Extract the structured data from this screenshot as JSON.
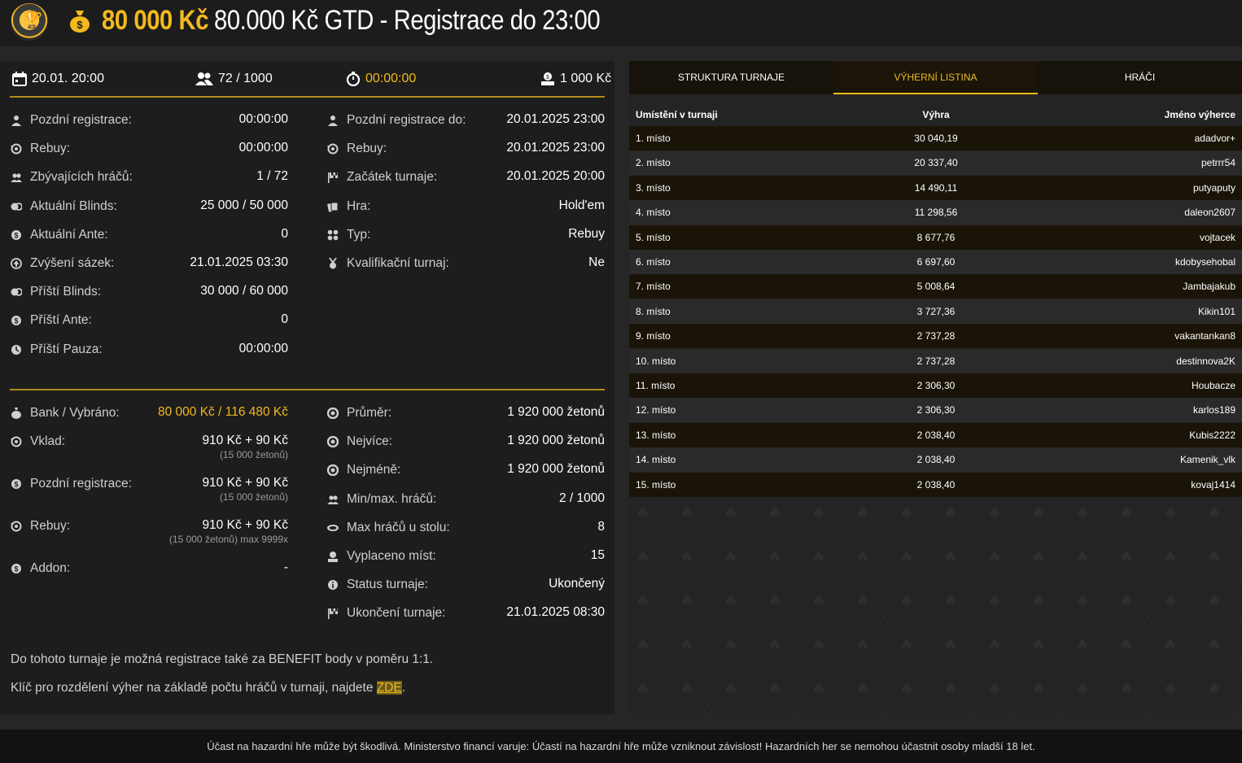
{
  "header": {
    "prize": "80 000 Kč",
    "title": "80.000 Kč GTD - Registrace do 23:00",
    "logo_icon": "trophy-icon",
    "prize_icon": "moneybag-icon"
  },
  "summary": {
    "date": "20.01. 20:00",
    "players": "72 / 1000",
    "timer": "00:00:00",
    "buyin": "1 000 Kč"
  },
  "details_left": [
    {
      "label": "Pozdní registrace:",
      "value": "00:00:00",
      "icon": "user-icon"
    },
    {
      "label": "Rebuy:",
      "value": "00:00:00",
      "icon": "rebuy-icon"
    },
    {
      "label": "Zbývajících hráčů:",
      "value": "1 / 72",
      "icon": "users-icon"
    },
    {
      "label": "Aktuální Blinds:",
      "value": "25 000 / 50 000",
      "icon": "chips-icon"
    },
    {
      "label": "Aktuální Ante:",
      "value": "0",
      "icon": "coin-icon"
    },
    {
      "label": "Zvýšení sázek:",
      "value": "21.01.2025 03:30",
      "icon": "raise-icon"
    },
    {
      "label": "Příští Blinds:",
      "value": "30 000 / 60 000",
      "icon": "chips-icon"
    },
    {
      "label": "Příští Ante:",
      "value": "0",
      "icon": "coin-icon"
    },
    {
      "label": "Příští Pauza:",
      "value": "00:00:00",
      "icon": "clock-icon"
    }
  ],
  "details_right": [
    {
      "label": "Pozdní registrace do:",
      "value": "20.01.2025 23:00",
      "icon": "user-icon"
    },
    {
      "label": "Rebuy:",
      "value": "20.01.2025 23:00",
      "icon": "rebuy-icon"
    },
    {
      "label": "Začátek turnaje:",
      "value": "20.01.2025 20:00",
      "icon": "flag-icon"
    },
    {
      "label": "Hra:",
      "value": "Hold'em",
      "icon": "cards-icon"
    },
    {
      "label": "Typ:",
      "value": "Rebuy",
      "icon": "grid-icon"
    },
    {
      "label": "Kvalifikační turnaj:",
      "value": "Ne",
      "icon": "medal-icon"
    }
  ],
  "money_left": [
    {
      "label": "Bank / Vybráno:",
      "value": "80 000 Kč / 116 480 Kč",
      "sub": "",
      "icon": "moneybag-icon"
    },
    {
      "label": "Vklad:",
      "value": "910 Kč + 90 Kč",
      "sub": "(15 000 žetonů)",
      "icon": "rebuy-icon"
    },
    {
      "label": "Pozdní registrace:",
      "value": "910 Kč + 90 Kč",
      "sub": "(15 000 žetonů)",
      "icon": "coin-icon"
    },
    {
      "label": "Rebuy:",
      "value": "910 Kč + 90 Kč",
      "sub": "(15 000 žetonů) max 9999x",
      "icon": "rebuy-icon"
    },
    {
      "label": "Addon:",
      "value": "-",
      "sub": "",
      "icon": "coin-icon"
    }
  ],
  "money_right": [
    {
      "label": "Průměr:",
      "value": "1 920 000 žetonů",
      "icon": "chip-icon"
    },
    {
      "label": "Nejvíce:",
      "value": "1 920 000 žetonů",
      "icon": "chip-icon"
    },
    {
      "label": "Nejméně:",
      "value": "1 920 000 žetonů",
      "icon": "chip-icon"
    },
    {
      "label": "Min/max. hráčů:",
      "value": "2 / 1000",
      "icon": "users-icon"
    },
    {
      "label": "Max hráčů u stolu:",
      "value": "8",
      "icon": "table-icon"
    },
    {
      "label": "Vyplaceno míst:",
      "value": "15",
      "icon": "payout-icon"
    },
    {
      "label": "Status turnaje:",
      "value": "Ukončený",
      "icon": "info-icon"
    },
    {
      "label": "Ukončení turnaje:",
      "value": "21.01.2025 08:30",
      "icon": "flag-icon"
    }
  ],
  "notes": {
    "benefit": "Do tohoto turnaje je možná registrace také za BENEFIT body v poměru 1:1.",
    "key_text": "Klíč pro rozdělení výher na základě počtu hráčů v turnaji, najdete ",
    "key_link": "ZDE",
    "key_end": "."
  },
  "tabs": [
    "STRUKTURA TURNAJE",
    "VÝHERNÍ LISTINA",
    "HRÁČI"
  ],
  "payout_table": {
    "headers": [
      "Umístění v turnaji",
      "Výhra",
      "Jméno výherce"
    ],
    "rows": [
      [
        "1. místo",
        "30 040,19",
        "adadvor+"
      ],
      [
        "2. místo",
        "20 337,40",
        "petrrr54"
      ],
      [
        "3. místo",
        "14 490,11",
        "putyaputy"
      ],
      [
        "4. místo",
        "11 298,56",
        "daleon2607"
      ],
      [
        "5. místo",
        "8 677,76",
        "vojtacek"
      ],
      [
        "6. místo",
        "6 697,60",
        "kdobysehobal"
      ],
      [
        "7. místo",
        "5 008,64",
        "Jambajakub"
      ],
      [
        "8. místo",
        "3 727,36",
        "Kikin101"
      ],
      [
        "9. místo",
        "2 737,28",
        "vakantankan8"
      ],
      [
        "10. místo",
        "2 737,28",
        "destinnova2K"
      ],
      [
        "11. místo",
        "2 306,30",
        "Houbacze"
      ],
      [
        "12. místo",
        "2 306,30",
        "karlos189"
      ],
      [
        "13. místo",
        "2 038,40",
        "Kubis2222"
      ],
      [
        "14. místo",
        "2 038,40",
        "Kamenik_vlk"
      ],
      [
        "15. místo",
        "2 038,40",
        "kovaj1414"
      ]
    ]
  },
  "footer": "Účast na hazardní hře může být škodlivá. Ministerstvo financí varuje: Účastí na hazardní hře může vzniknout závislost! Hazardních her se nemohou účastnit osoby mladší 18 let.",
  "colors": {
    "accent": "#f3b91e",
    "panel": "#1d1d1d",
    "background": "#262626"
  }
}
